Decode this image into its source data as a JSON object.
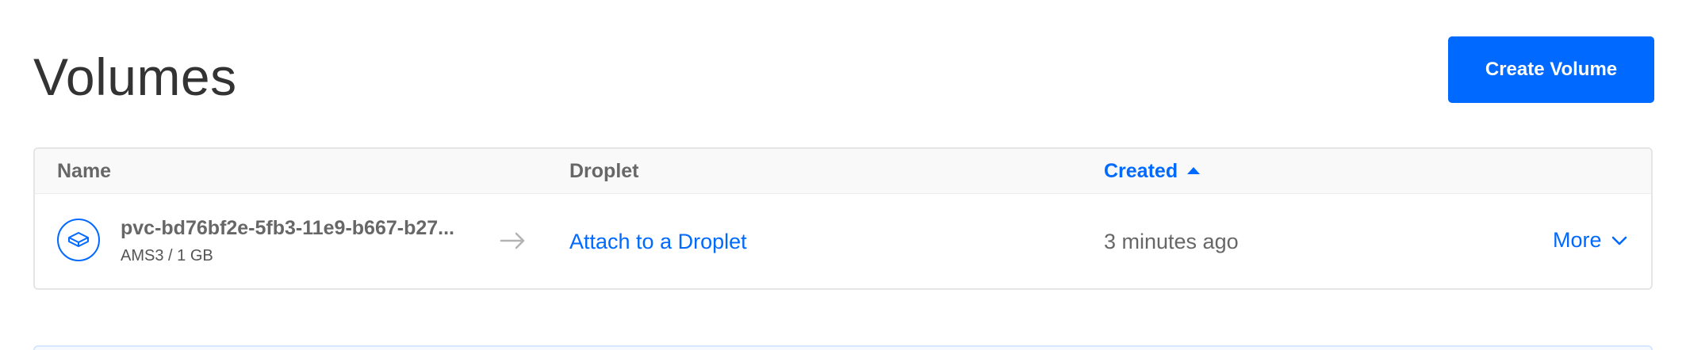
{
  "header": {
    "title": "Volumes",
    "create_button_label": "Create Volume"
  },
  "table": {
    "columns": {
      "name": "Name",
      "droplet": "Droplet",
      "created": "Created"
    },
    "sort": {
      "column": "created",
      "direction": "ascending",
      "icon": "caret-up-icon"
    },
    "rows": [
      {
        "icon": "volume-icon",
        "name": "pvc-bd76bf2e-5fb3-11e9-b667-b27...",
        "meta": "AMS3 / 1 GB",
        "arrow_icon": "arrow-right-icon",
        "droplet_action": "Attach to a Droplet",
        "created": "3 minutes ago",
        "more_label": "More",
        "more_icon": "chevron-down-icon"
      }
    ]
  },
  "colors": {
    "accent": "#0069ff",
    "text": "#676767",
    "title": "#333333"
  }
}
